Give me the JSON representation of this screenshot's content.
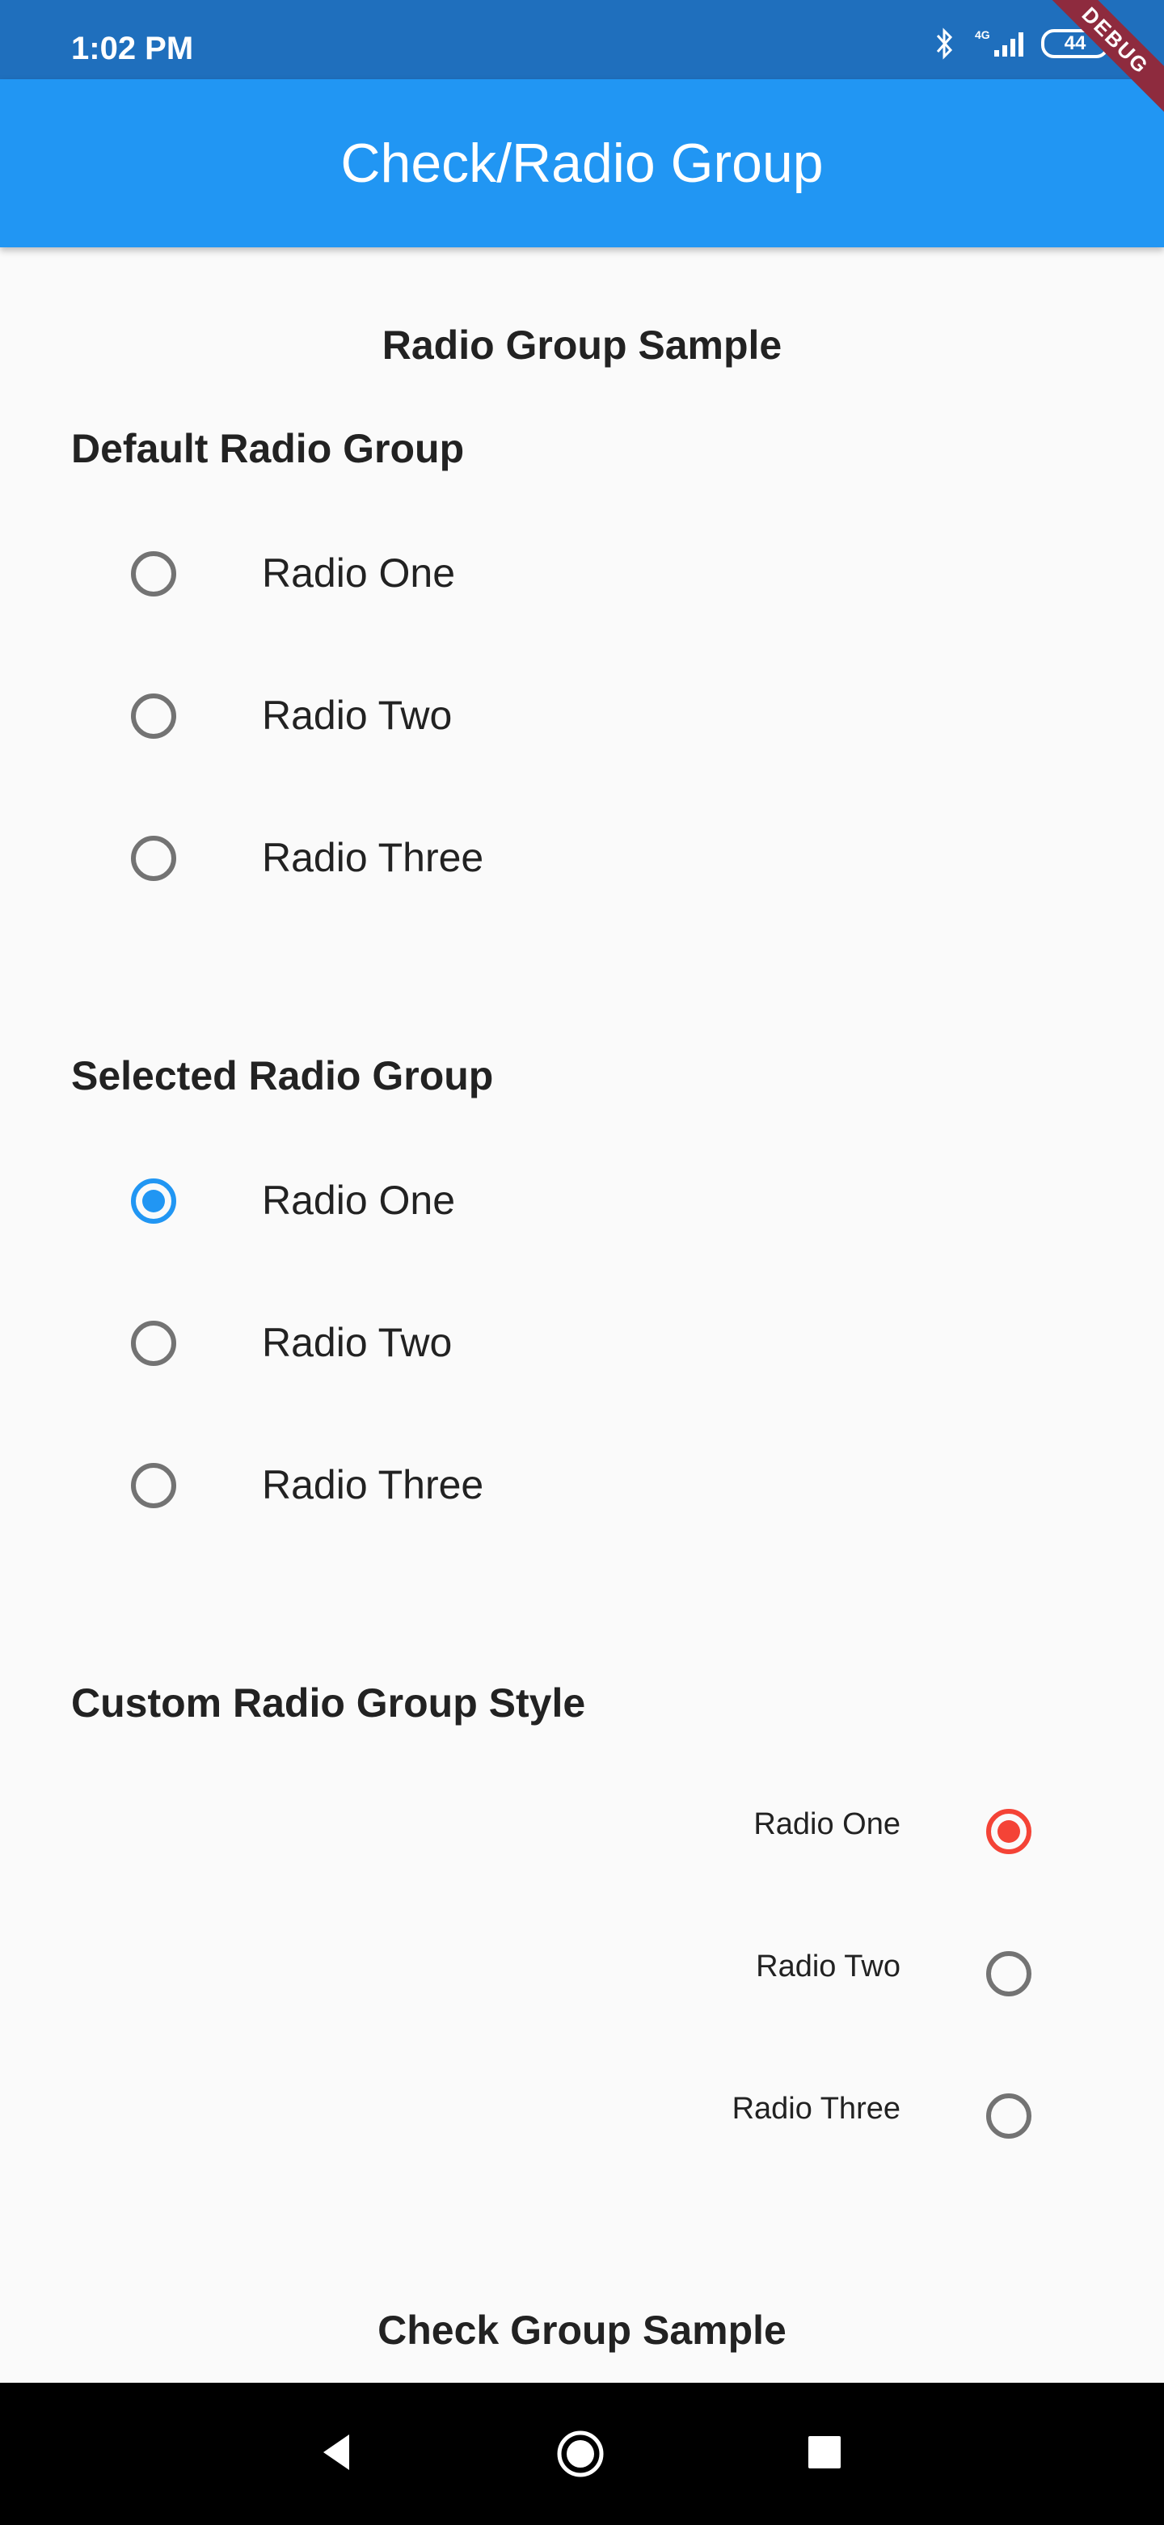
{
  "status_bar": {
    "time": "1:02 PM",
    "battery_level": "44",
    "network": "4G",
    "icons": [
      "bluetooth-icon",
      "signal-icon",
      "battery-icon"
    ]
  },
  "debug_banner": "DEBUG",
  "app_bar": {
    "title": "Check/Radio Group"
  },
  "radio_section": {
    "title": "Radio Group Sample",
    "groups": [
      {
        "title": "Default Radio Group",
        "selected_index": null,
        "options": [
          "Radio One",
          "Radio Two",
          "Radio Three"
        ]
      },
      {
        "title": "Selected Radio Group",
        "selected_index": 0,
        "options": [
          "Radio One",
          "Radio Two",
          "Radio Three"
        ]
      },
      {
        "title": "Custom Radio Group Style",
        "selected_index": 0,
        "options": [
          "Radio One",
          "Radio Two",
          "Radio Three"
        ]
      }
    ]
  },
  "check_section": {
    "title": "Check Group Sample"
  },
  "colors": {
    "app_bar": "#2196f3",
    "status_bar": "#1f6fbd",
    "selected_default": "#2196f3",
    "selected_custom": "#f44336",
    "unselected": "#737373"
  },
  "nav_bar": {
    "icons": [
      "back-icon",
      "home-icon",
      "recents-icon"
    ]
  }
}
